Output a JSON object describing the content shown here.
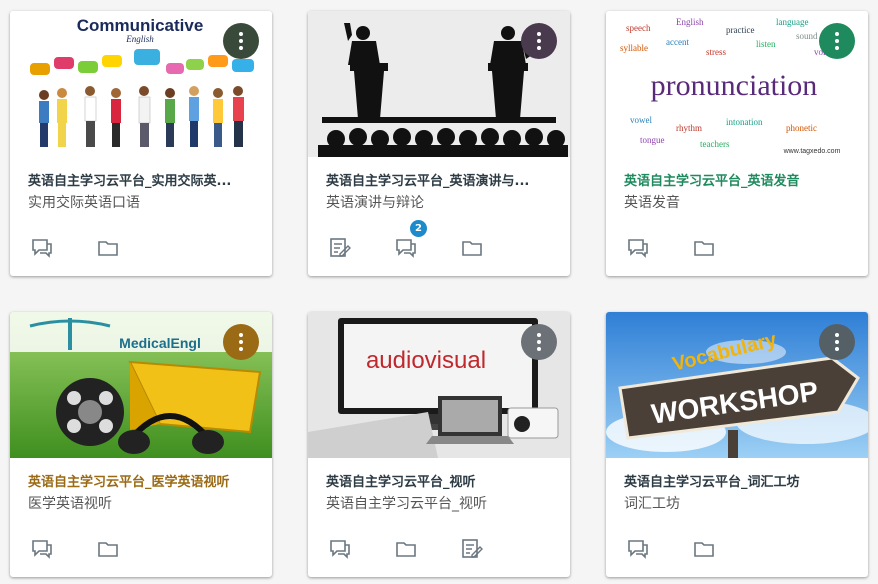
{
  "colors": {
    "title_default": "#2d3b45",
    "title_green": "#1f8a5e",
    "title_gold": "#9a6a14",
    "badge": "#1d8acb"
  },
  "courses": [
    {
      "title": "英语自主学习云平台_实用交际英...",
      "subtitle": "实用交际英语口语",
      "menu_color": "#3a4a3a",
      "title_color": "#2d3b45",
      "image_texts": [
        "Communicative",
        "English"
      ],
      "actions": [
        "announcements-icon",
        "files-icon"
      ]
    },
    {
      "title": "英语自主学习云平台_英语演讲与...",
      "subtitle": "英语演讲与辩论",
      "menu_color": "#4a3a4e",
      "title_color": "#2d3b45",
      "badge": "2",
      "actions": [
        "assignments-icon",
        "discussions-icon",
        "files-icon"
      ]
    },
    {
      "title": "英语自主学习云平台_英语发音",
      "subtitle": "英语发音",
      "menu_color": "#1f8a5e",
      "title_color": "#1f8a5e",
      "image_texts": [
        "pronunciation",
        "www.tagxedo.com"
      ],
      "actions": [
        "announcements-icon",
        "files-icon"
      ]
    },
    {
      "title": "英语自主学习云平台_医学英语视听",
      "subtitle": "医学英语视听",
      "menu_color": "#9a6a14",
      "title_color": "#9a6a14",
      "image_texts": [
        "MedicalEngl"
      ],
      "actions": [
        "announcements-icon",
        "files-icon"
      ]
    },
    {
      "title": "英语自主学习云平台_视听",
      "subtitle": "英语自主学习云平台_视听",
      "menu_color": "#6b7176",
      "title_color": "#2d3b45",
      "image_texts": [
        "audiovisual"
      ],
      "actions": [
        "announcements-icon",
        "files-icon",
        "assignments-icon"
      ]
    },
    {
      "title": "英语自主学习云平台_词汇工坊",
      "subtitle": "词汇工坊",
      "menu_color": "#556066",
      "title_color": "#2d3b45",
      "image_texts": [
        "Vocabulary",
        "WORKSHOP"
      ],
      "actions": [
        "announcements-icon",
        "files-icon"
      ]
    }
  ]
}
